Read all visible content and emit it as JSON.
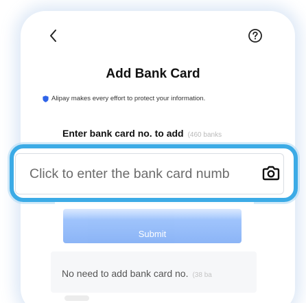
{
  "nav": {
    "back_icon": "chevron-left-icon",
    "help_icon": "question-circle-icon"
  },
  "page": {
    "title": "Add Bank Card",
    "notice": "Alipay makes every effort to protect your information."
  },
  "card_entry": {
    "label": "Enter bank card no. to add",
    "supported_count": "(460 banks",
    "input_placeholder": "Click to enter the bank card numb",
    "input_value": "",
    "camera_icon": "camera-icon"
  },
  "actions": {
    "submit_label": "Submit"
  },
  "alternative": {
    "label": "No need to add bank card no.",
    "count": "(38 ba"
  },
  "colors": {
    "highlight_border": "#3cabe6",
    "submit_blue": "#4a8ef5",
    "shield_blue": "#2f64e8"
  }
}
